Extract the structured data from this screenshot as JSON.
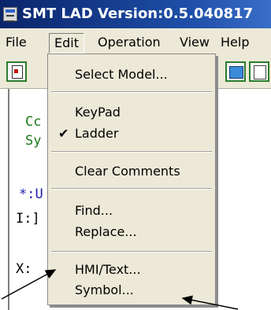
{
  "window": {
    "title": "SMT LAD Version:0.5.040817"
  },
  "menubar": {
    "file": "File",
    "edit": "Edit",
    "operation": "Operation",
    "view": "View",
    "help": "Help"
  },
  "workspace": {
    "line1": "Cc",
    "line2": "Sy",
    "line3": "*:U",
    "line4": "I:]",
    "line5": "X:"
  },
  "edit_menu": {
    "select_model": "Select Model...",
    "keypad": "KeyPad",
    "ladder": "Ladder",
    "ladder_checked": true,
    "clear_comments": "Clear Comments",
    "find": "Find...",
    "replace": "Replace...",
    "hmi_text": "HMI/Text...",
    "symbol": "Symbol..."
  },
  "icons": {
    "check": "check-icon",
    "app": "app-icon"
  },
  "colors": {
    "titlebar": "#0a246a",
    "menu_bg": "#ece9d8",
    "comment_text": "#1a7a1a",
    "label_text": "#1a1ab0"
  }
}
